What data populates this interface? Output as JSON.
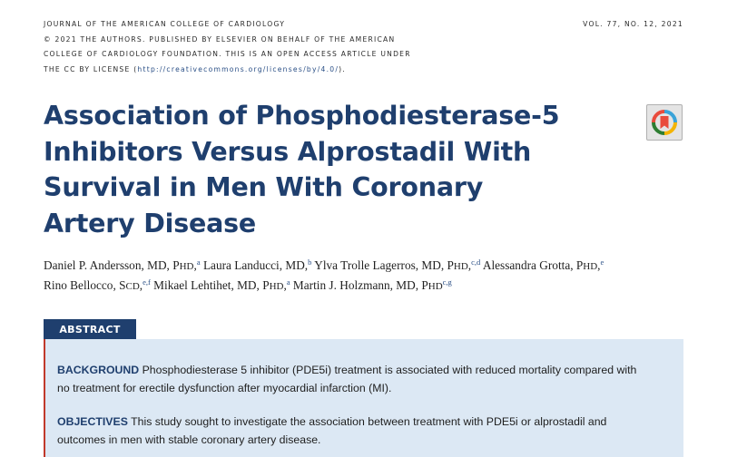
{
  "header": {
    "journal": "JOURNAL OF THE AMERICAN COLLEGE OF CARDIOLOGY",
    "copyright": "© 2021 THE AUTHORS. PUBLISHED BY ELSEVIER ON BEHALF OF THE AMERICAN",
    "foundation": "COLLEGE OF CARDIOLOGY FOUNDATION. THIS IS AN OPEN ACCESS ARTICLE UNDER",
    "license_prefix": "THE CC BY LICENSE (",
    "license_url": "http://creativecommons.org/licenses/by/4.0/",
    "license_suffix": ").",
    "volume": "VOL. 77, NO. 12, 2021"
  },
  "title_lines": [
    "Association of Phosphodiesterase-5",
    "Inhibitors Versus Alprostadil With",
    "Survival in Men With Coronary",
    "Artery Disease"
  ],
  "badge": {
    "icon": "check-for-updates-icon",
    "colors": [
      "#e94b3c",
      "#f4b400",
      "#3aa3d8",
      "#2e7d32"
    ]
  },
  "authors": {
    "a1_name": "Daniel P. Andersson, MD, P",
    "a1_deg": "HD",
    "a1_sup": "a",
    "a2_name": "Laura Landucci, MD,",
    "a2_sup": "b",
    "a3_name": "Ylva Trolle Lagerros, MD, P",
    "a3_deg": "HD",
    "a3_sup": "c,d",
    "a4_name": "Alessandra Grotta, P",
    "a4_deg": "HD",
    "a4_sup": "e",
    "a5_name": "Rino Bellocco, S",
    "a5_deg": "CD",
    "a5_sup": "e,f",
    "a6_name": "Mikael Lehtihet, MD, P",
    "a6_deg": "HD",
    "a6_sup": "a",
    "a7_name": "Martin J. Holzmann, MD, P",
    "a7_deg": "HD",
    "a7_sup": "c,g"
  },
  "abstract": {
    "tab_label": "ABSTRACT",
    "background_head": "BACKGROUND",
    "background_line1": "Phosphodiesterase 5 inhibitor (PDE5i) treatment is associated with reduced mortality compared with",
    "background_line2": "no treatment for erectile dysfunction after myocardial infarction (MI).",
    "objectives_head": "OBJECTIVES",
    "objectives_line1": "This study sought to investigate the association between treatment with PDE5i or alprostadil and",
    "objectives_line2": "outcomes in men with stable coronary artery disease."
  }
}
